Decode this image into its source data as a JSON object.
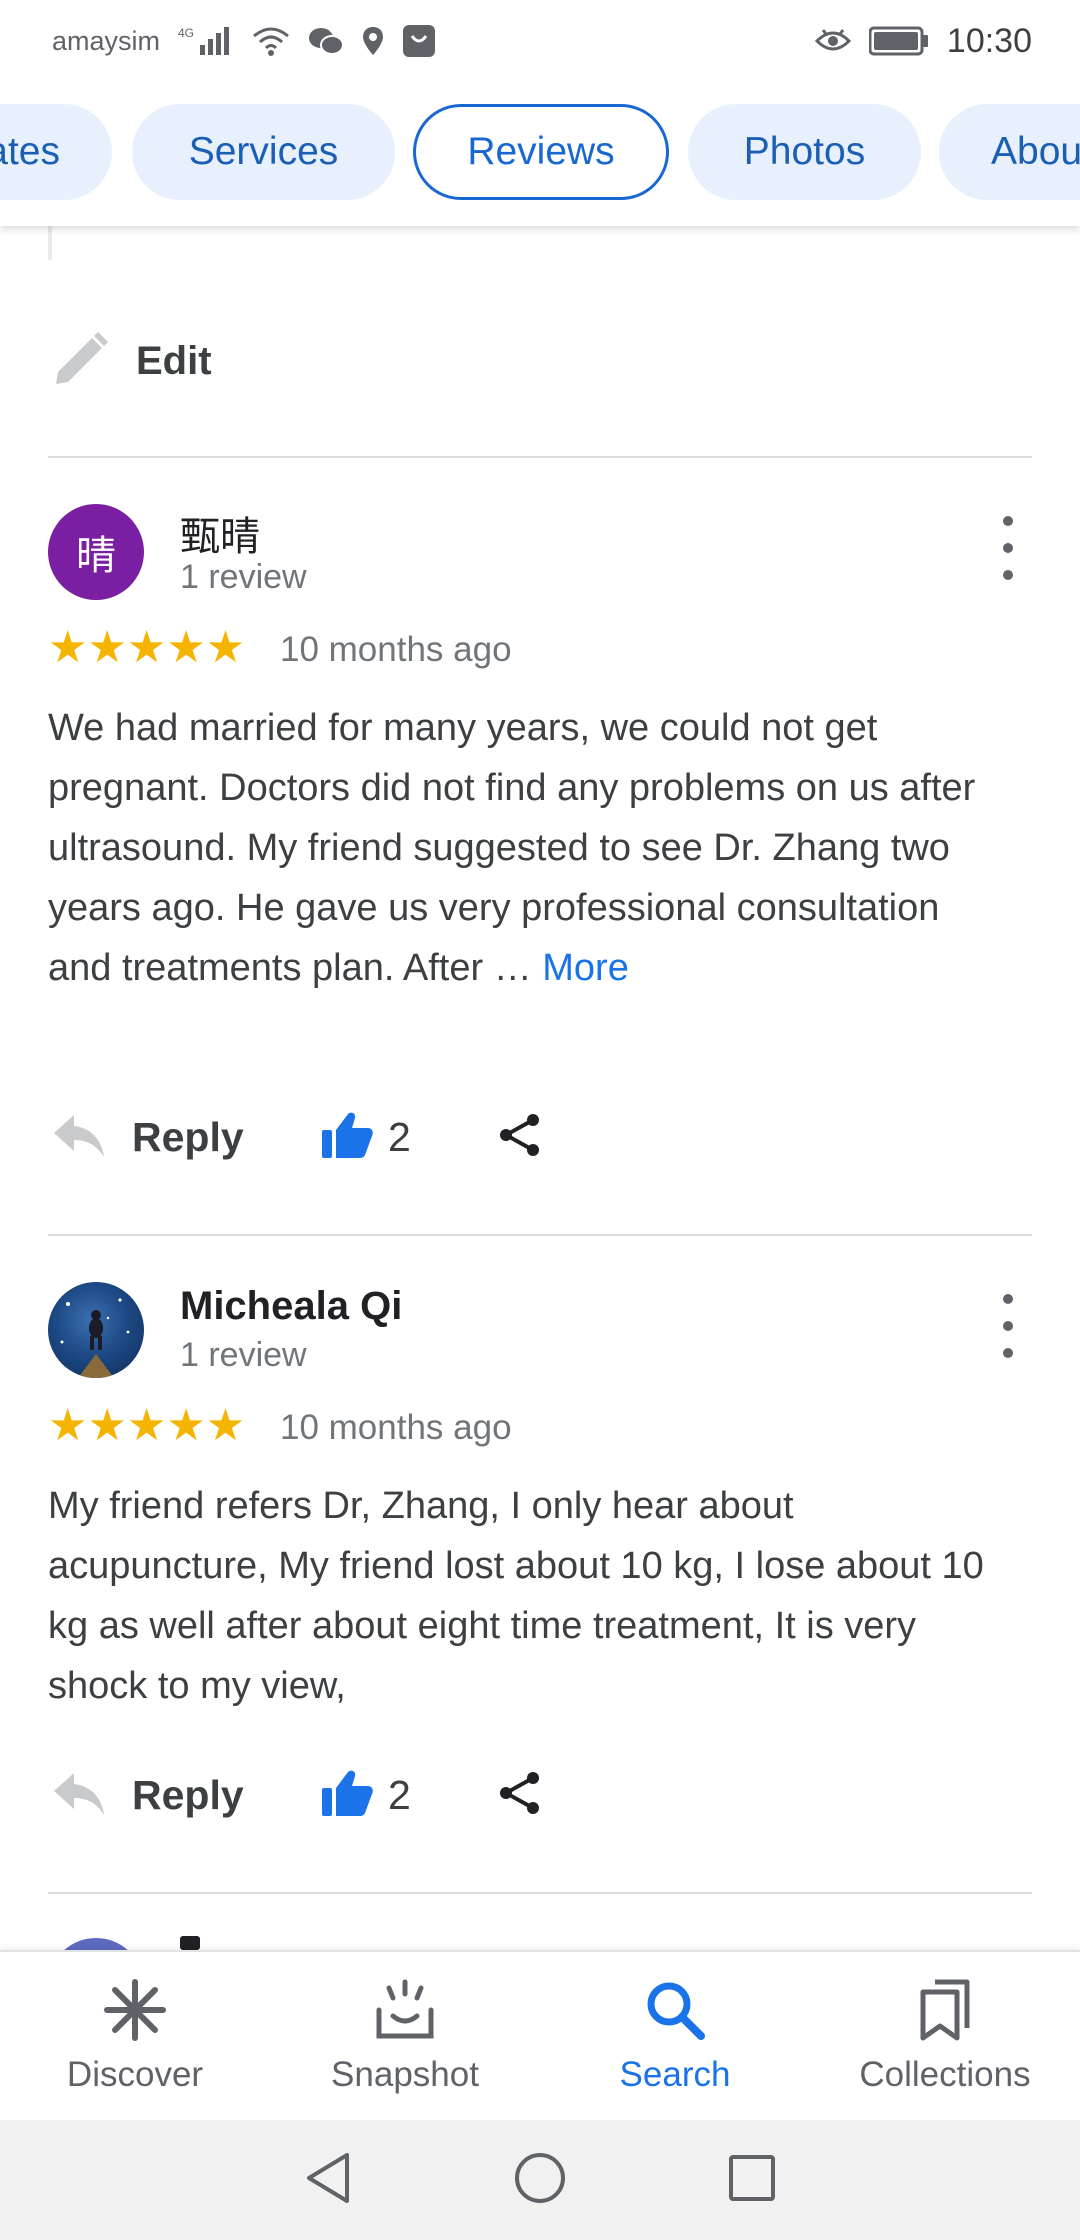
{
  "status_bar": {
    "carrier": "amaysim",
    "network": "4G",
    "time": "10:30",
    "icons": [
      "signal-icon",
      "wifi-icon",
      "wechat-icon",
      "location-icon",
      "shopping-bag-icon",
      "eye-icon",
      "battery-icon"
    ]
  },
  "chips": [
    {
      "label": "Updates",
      "visible_label": "ates",
      "active": false
    },
    {
      "label": "Services",
      "active": false
    },
    {
      "label": "Reviews",
      "active": true
    },
    {
      "label": "Photos",
      "active": false
    },
    {
      "label": "About",
      "visible_label": "Abou",
      "active": false
    }
  ],
  "edit": {
    "label": "Edit",
    "icon": "pencil-icon"
  },
  "reviews": [
    {
      "avatar_text": "晴",
      "avatar_color": "#7b1fa2",
      "name": "甄晴",
      "review_count": "1 review",
      "stars": "★★★★★",
      "rating": 5,
      "age": "10 months ago",
      "text": "We had married for  many years, we could not get pregnant. Doctors did  not find any problems on us after ultrasound. My friend suggested to see Dr. Zhang two years ago. He gave us very professional consultation and treatments plan. After … ",
      "more_label": "More",
      "reply_label": "Reply",
      "likes": "2"
    },
    {
      "avatar_text": "",
      "name": "Micheala Qi",
      "review_count": "1 review",
      "stars": "★★★★★",
      "rating": 5,
      "age": "10 months ago",
      "text": "My friend refers Dr, Zhang, I only hear about acupuncture, My friend lost about 10 kg, I lose about 10 kg as well after about eight time treatment, It is very shock to my view,",
      "reply_label": "Reply",
      "likes": "2"
    }
  ],
  "bottom_nav": [
    {
      "label": "Discover",
      "icon": "asterisk-icon",
      "active": false
    },
    {
      "label": "Snapshot",
      "icon": "snapshot-icon",
      "active": false
    },
    {
      "label": "Search",
      "icon": "search-icon",
      "active": true
    },
    {
      "label": "Collections",
      "icon": "collections-icon",
      "active": false
    }
  ],
  "colors": {
    "accent": "#1a73e8",
    "chip_bg": "#e8f0fe",
    "star": "#f5b400",
    "avatar_purple": "#7b1fa2"
  }
}
